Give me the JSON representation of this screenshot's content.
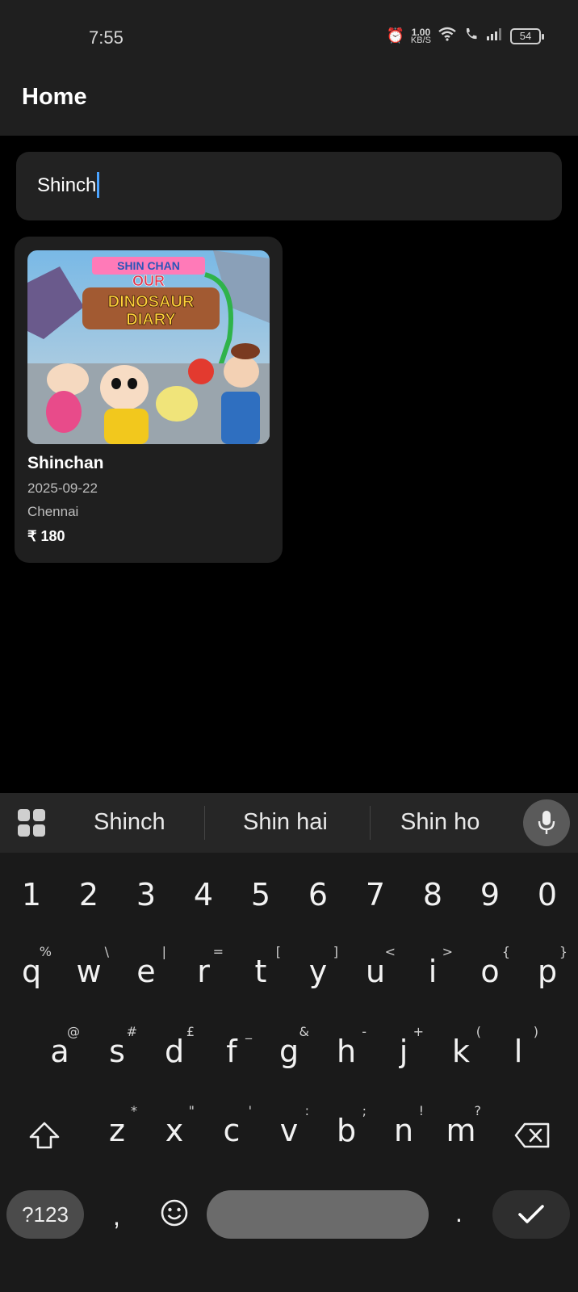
{
  "status_bar": {
    "time": "7:55",
    "net_speed_value": "1.00",
    "net_speed_unit": "KB/S",
    "battery": "54"
  },
  "app_bar": {
    "title": "Home"
  },
  "search": {
    "value": "Shinch"
  },
  "results": [
    {
      "poster_text": [
        "SHIN CHAN",
        "OUR",
        "DINOSAUR",
        "DIARY"
      ],
      "title": "Shinchan",
      "date": "2025-09-22",
      "city": "Chennai",
      "price": "₹ 180"
    }
  ],
  "keyboard": {
    "suggestions": [
      "Shinch",
      "Shin hai",
      "Shin ho"
    ],
    "number_row": [
      "1",
      "2",
      "3",
      "4",
      "5",
      "6",
      "7",
      "8",
      "9",
      "0"
    ],
    "row1": [
      [
        "q",
        "%"
      ],
      [
        "w",
        "\\"
      ],
      [
        "e",
        "|"
      ],
      [
        "r",
        "="
      ],
      [
        "t",
        "["
      ],
      [
        "y",
        "]"
      ],
      [
        "u",
        "<"
      ],
      [
        "i",
        ">"
      ],
      [
        "o",
        "{"
      ],
      [
        "p",
        "}"
      ]
    ],
    "row2": [
      [
        "a",
        "@"
      ],
      [
        "s",
        "#"
      ],
      [
        "d",
        "£"
      ],
      [
        "f",
        "_"
      ],
      [
        "g",
        "&"
      ],
      [
        "h",
        "-"
      ],
      [
        "j",
        "+"
      ],
      [
        "k",
        "("
      ],
      [
        "l",
        ")"
      ]
    ],
    "row3": [
      [
        "z",
        "*"
      ],
      [
        "x",
        "\""
      ],
      [
        "c",
        "'"
      ],
      [
        "v",
        ":"
      ],
      [
        "b",
        ";"
      ],
      [
        "n",
        "!"
      ],
      [
        "m",
        "?"
      ]
    ],
    "symbols_label": "?123",
    "comma": ",",
    "period": "."
  },
  "colors": {
    "accent_caret": "#4aa3ff",
    "background": "#000000",
    "surface": "#1f1f1f"
  }
}
